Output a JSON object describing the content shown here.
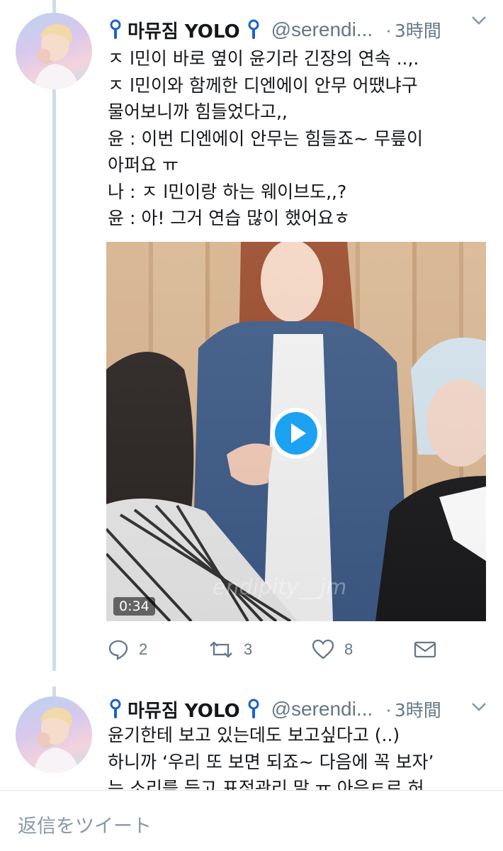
{
  "tweets": [
    {
      "display_name": "마뮤짐 YOLO",
      "handle": "@serendi...",
      "dot": "·",
      "time": "3時間",
      "text_lines": [
        "ㅈ l민이 바로 옆이 윤기라 긴장의 연속 ..,.",
        "ㅈ l민이와 함께한 디엔에이 안무 어땠냐구",
        "물어보니까 힘들었다고,,",
        "윤 : 이번 디엔에이 안무는 힘들죠~ 무릎이",
        "아퍼요 ㅠ",
        "나 : ㅈ l민이랑 하는 웨이브도,,?",
        "윤 : 아! 그거 연습 많이 했어요ㅎ"
      ],
      "media": {
        "type": "video",
        "duration": "0:34",
        "watermark": "endipity__jm"
      },
      "actions": {
        "reply_count": "2",
        "retweet_count": "3",
        "like_count": "8"
      }
    },
    {
      "display_name": "마뮤짐 YOLO",
      "handle": "@serendi...",
      "dot": "·",
      "time": "3時間",
      "text_lines": [
        "윤기한테 보고 있는데도 보고싶다고 (..)",
        "하니까 ‘우리 또 보면 되죠~ 다음에 꼭 보자’",
        "는 소리를 듣고 표정관리 말 ㅠ 아음ㅌ르 허"
      ]
    }
  ],
  "reply_bar": {
    "placeholder": "返信をツイート"
  },
  "colors": {
    "accent": "#1da1f2",
    "secondary_text": "#657786",
    "thread_line": "#d0dde7"
  },
  "icons": {
    "name_badge": "lightstick-icon",
    "menu": "chevron-down-icon",
    "reply": "reply-icon",
    "retweet": "retweet-icon",
    "like": "heart-icon",
    "share": "envelope-icon",
    "play": "play-icon"
  }
}
